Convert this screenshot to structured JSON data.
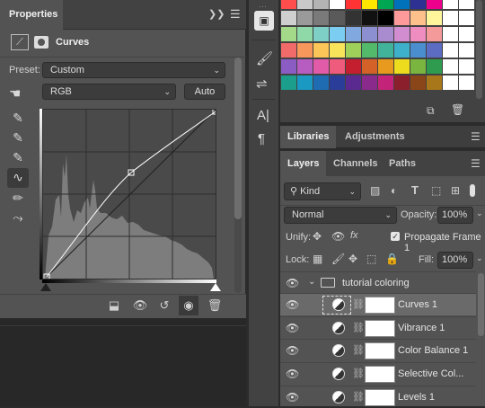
{
  "properties": {
    "tab_title": "Properties",
    "panel_title": "Curves",
    "preset_label": "Preset:",
    "preset_value": "Custom",
    "channel_value": "RGB",
    "auto_label": "Auto"
  },
  "libraries_tab": "Libraries",
  "adjustments_tab": "Adjustments",
  "layers": {
    "tabs": [
      "Layers",
      "Channels",
      "Paths"
    ],
    "filter_kind": "Kind",
    "blend_mode": "Normal",
    "opacity_label": "Opacity:",
    "opacity_value": "100%",
    "unify_label": "Unify:",
    "propagate_label": "Propagate Frame 1",
    "lock_label": "Lock:",
    "fill_label": "Fill:",
    "fill_value": "100%",
    "group_name": "tutorial coloring",
    "items": [
      {
        "name": "Curves 1"
      },
      {
        "name": "Vibrance 1"
      },
      {
        "name": "Color Balance 1"
      },
      {
        "name": "Selective Col..."
      },
      {
        "name": "Levels 1"
      }
    ]
  },
  "swatch_colors": [
    [
      "#ff4d4d",
      "#c9c9c9",
      "#b3b3b3",
      "#ffffff",
      "#ff3333",
      "#ffe600",
      "#00a651",
      "#0072bc",
      "#2e3192",
      "#ec008c",
      "#ffffff",
      "#ffffff"
    ],
    [
      "#cfcfcf",
      "#9a9a9a",
      "#7a7a7a",
      "#5a5a5a",
      "#333333",
      "#111111",
      "#000000",
      "#ff9a9a",
      "#ffc18c",
      "#fff59a",
      "#ffffff",
      "#ffffff"
    ],
    [
      "#a4d98a",
      "#8fd9a8",
      "#7ed0c6",
      "#7ccdf2",
      "#81a9e0",
      "#8c8fd0",
      "#a98bd0",
      "#d28dd1",
      "#f08dc0",
      "#f59a9a",
      "#ffffff",
      "#ffffff"
    ],
    [
      "#f26b6b",
      "#f7975c",
      "#fbc558",
      "#f7e45a",
      "#9fd05a",
      "#53b96b",
      "#40b39a",
      "#3fb0c9",
      "#4a8ed0",
      "#5b6cc2",
      "#ffffff",
      "#ffffff"
    ],
    [
      "#8b5cc4",
      "#b75dc1",
      "#e15ba8",
      "#ef5b7c",
      "#c31f2e",
      "#d46127",
      "#e79a1e",
      "#eddb1e",
      "#7ab53f",
      "#2f9b4f",
      "#ffffff",
      "#ffffff"
    ],
    [
      "#1b9e8c",
      "#1a99c2",
      "#1f6cb3",
      "#2a3d99",
      "#5b2a91",
      "#8a2a8c",
      "#c3247a",
      "#8c1f2c",
      "#8a4518",
      "#a8771a",
      "#ffffff",
      "#ffffff"
    ]
  ]
}
